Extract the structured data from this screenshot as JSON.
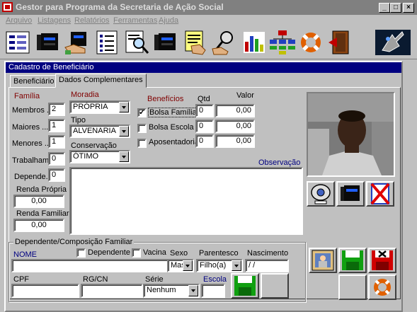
{
  "window": {
    "title": "Gestor para Programa da Secretaria de Ação Social",
    "minimize": "_",
    "maximize": "□",
    "close": "×"
  },
  "menu": [
    "Arquivo",
    "Listagens",
    "Relatórios",
    "Ferramentas",
    "Ajuda"
  ],
  "toolbar": {
    "icons": [
      "form-list-icon",
      "disk-drive-icon",
      "disk-hand-icon",
      "checklist-icon",
      "search-document-icon",
      "disk-drive-2-icon",
      "notepad-hand-icon",
      "magnifier-hand-icon",
      "bar-chart-icon",
      "org-chart-icon",
      "lifebuoy-icon",
      "exit-door-icon",
      "logo-icon"
    ]
  },
  "form": {
    "title": "Cadastro de Beneficiário",
    "tabs": [
      "Beneficiário",
      "Dados Complementares"
    ],
    "familia": {
      "heading": "Família",
      "membros_label": "Membros .:",
      "membros": "2",
      "maiores_label": "Maiores ...:",
      "maiores": "1",
      "menores_label": "Menores ..:",
      "menores": "1",
      "trabalham_label": "Trabalham",
      "trabalham": "0",
      "depende_label": "Depende.:",
      "depende": "0",
      "renda_propria_label": "Renda Própria",
      "renda_propria": "0,00",
      "renda_familiar_label": "Renda Familiar",
      "renda_familiar": "0,00"
    },
    "moradia": {
      "heading": "Moradia",
      "value": "PRÓPRIA",
      "tipo_label": "Tipo",
      "tipo": "ALVENARIA",
      "conservacao_label": "Conservação",
      "conservacao": "ÓTIMO"
    },
    "beneficios": {
      "heading": "Benefícios",
      "qtd_label": "Qtd",
      "valor_label": "Valor",
      "items": [
        {
          "label": "Bolsa Família",
          "checked": "✓",
          "qtd": "0",
          "valor": "0,00"
        },
        {
          "label": "Bolsa Escola",
          "checked": "",
          "qtd": "0",
          "valor": "0,00"
        },
        {
          "label": "Aposentadoria",
          "checked": "",
          "qtd": "0",
          "valor": "0,00"
        }
      ]
    },
    "observacao_label": "Observação",
    "observacao": ""
  },
  "dependente": {
    "heading": "Dependente/Composição Familiar",
    "nome_label": "NOME",
    "nome": "",
    "dependente_label": "Dependente",
    "vacina_label": "Vacina",
    "sexo_label": "Sexo",
    "sexo": "Mas",
    "parentesco_label": "Parentesco",
    "parentesco": "Filho(a)",
    "nascimento_label": "Nascimento",
    "nascimento": " / /",
    "cpf_label": "CPF",
    "cpf": "",
    "rg_label": "RG/CN",
    "rg": "",
    "serie_label": "Série",
    "serie": "Nenhum",
    "escola_label": "Escola",
    "escola": ""
  },
  "colors": {
    "accent_title": "#000080",
    "label_red": "#800000",
    "face": "#c0c0c0"
  }
}
